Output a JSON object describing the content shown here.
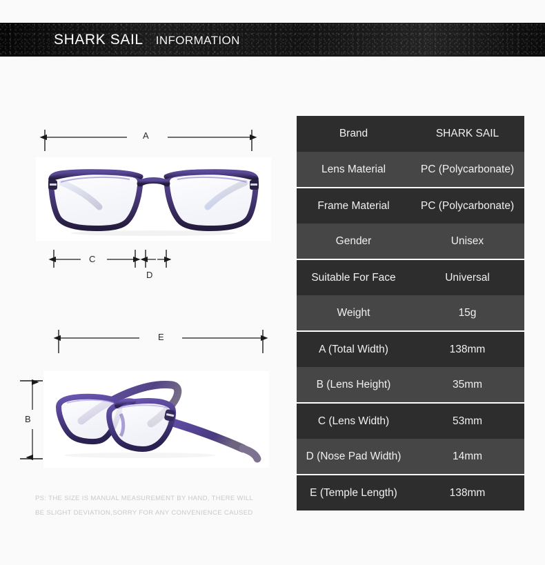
{
  "header": {
    "brand": "SHARK SAIL",
    "section": "INFORMATION"
  },
  "diagram": {
    "labels": {
      "A": "A",
      "B": "B",
      "C": "C",
      "D": "D",
      "E": "E"
    },
    "front_view_alt": "eyeglasses-front-view",
    "angled_view_alt": "eyeglasses-angled-view"
  },
  "disclaimer": {
    "line1": "PS: THE SIZE IS MANUAL MEASUREMENT BY HAND, THERE WILL",
    "line2": "BE SLIGHT DEVIATION,SORRY FOR ANY CONVENIENCE CAUSED"
  },
  "spec_table": {
    "rows": [
      {
        "key": "Brand",
        "value": "SHARK SAIL"
      },
      {
        "key": "Lens Material",
        "value": "PC (Polycarbonate)"
      },
      {
        "key": "Frame Material",
        "value": "PC (Polycarbonate)"
      },
      {
        "key": "Gender",
        "value": "Unisex"
      },
      {
        "key": "Suitable For Face",
        "value": "Universal"
      },
      {
        "key": "Weight",
        "value": "15g"
      },
      {
        "key": "A (Total Width)",
        "value": "138mm"
      },
      {
        "key": "B (Lens Height)",
        "value": "35mm"
      },
      {
        "key": "C (Lens Width)",
        "value": "53mm"
      },
      {
        "key": "D (Nose Pad Width)",
        "value": "14mm"
      },
      {
        "key": "E (Temple Length)",
        "value": "138mm"
      }
    ]
  },
  "colors": {
    "page_background": "#fafafa",
    "header_background": "#121212",
    "row_dark": "#2d2d2d",
    "row_light": "#464646",
    "row_text": "#f0f0f0",
    "separator": "#fdfdfd",
    "frame_purple": "#4a3a7a",
    "dimension_line": "#1a1a1a",
    "disclaimer_text": "#c9c9c9"
  }
}
